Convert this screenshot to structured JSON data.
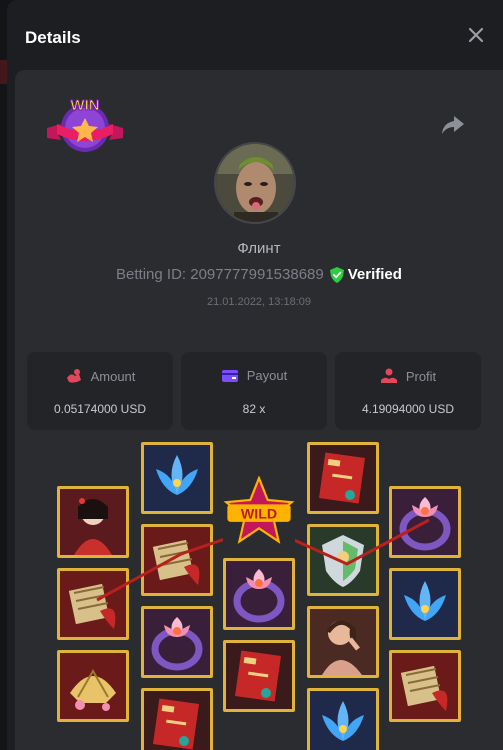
{
  "modal": {
    "title": "Details"
  },
  "player": {
    "name": "Флинт",
    "betting_id_label": "Betting ID: 2097777991538689",
    "verified_label": "Verified",
    "date": "21.01.2022, 13:18:09"
  },
  "badge": {
    "text": "WIN"
  },
  "stats": {
    "amount": {
      "label": "Amount",
      "value": "0.05174000 USD"
    },
    "payout": {
      "label": "Payout",
      "value": "82 x"
    },
    "profit": {
      "label": "Profit",
      "value": "4.19094000 USD"
    }
  },
  "reels": [
    [
      "geisha",
      "scroll",
      "fan"
    ],
    [
      "lotus",
      "scroll",
      "ring",
      "book"
    ],
    [
      "wild",
      "ring",
      "book"
    ],
    [
      "book",
      "shield",
      "woman",
      "lotus"
    ],
    [
      "ring",
      "lotus",
      "scroll"
    ]
  ],
  "wild_text": "WILD",
  "colors": {
    "accent": "#e0b43a",
    "verified": "#2ecc40",
    "payline": "#b8201e"
  }
}
